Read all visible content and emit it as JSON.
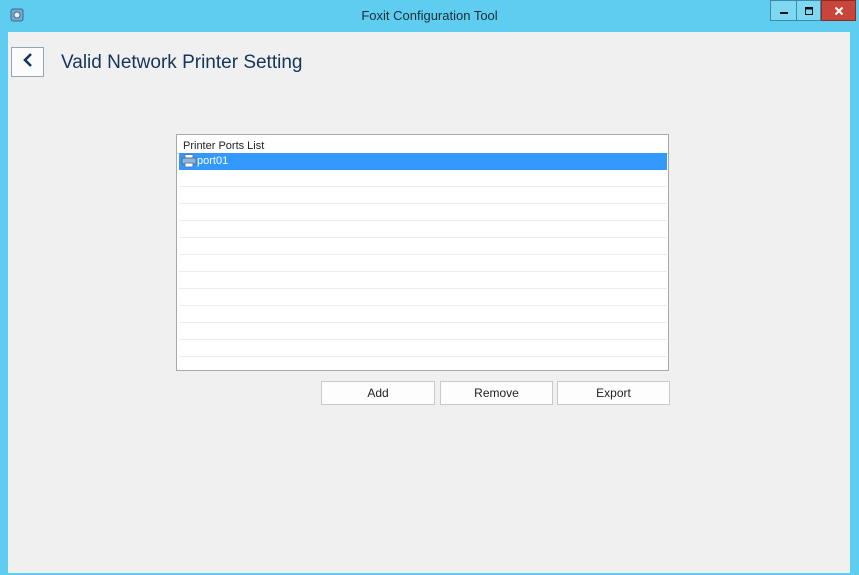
{
  "window": {
    "title": "Foxit Configuration Tool",
    "app_icon": "gear-icon",
    "controls": {
      "minimize_icon": "minimize-icon",
      "maximize_icon": "maximize-icon",
      "close_icon": "close-icon"
    }
  },
  "header": {
    "back_icon": "chevron-left-icon",
    "title": "Valid Network Printer Setting"
  },
  "printer_list": {
    "header": "Printer Ports List",
    "items": [
      {
        "label": "port01",
        "icon": "printer-icon",
        "selected": true
      }
    ],
    "empty_rows": 11
  },
  "actions": {
    "add_label": "Add",
    "remove_label": "Remove",
    "export_label": "Export"
  },
  "colors": {
    "titlebar": "#5fcdef",
    "selection": "#3399ff",
    "close_button": "#c8453b",
    "title_text": "#15355a"
  }
}
